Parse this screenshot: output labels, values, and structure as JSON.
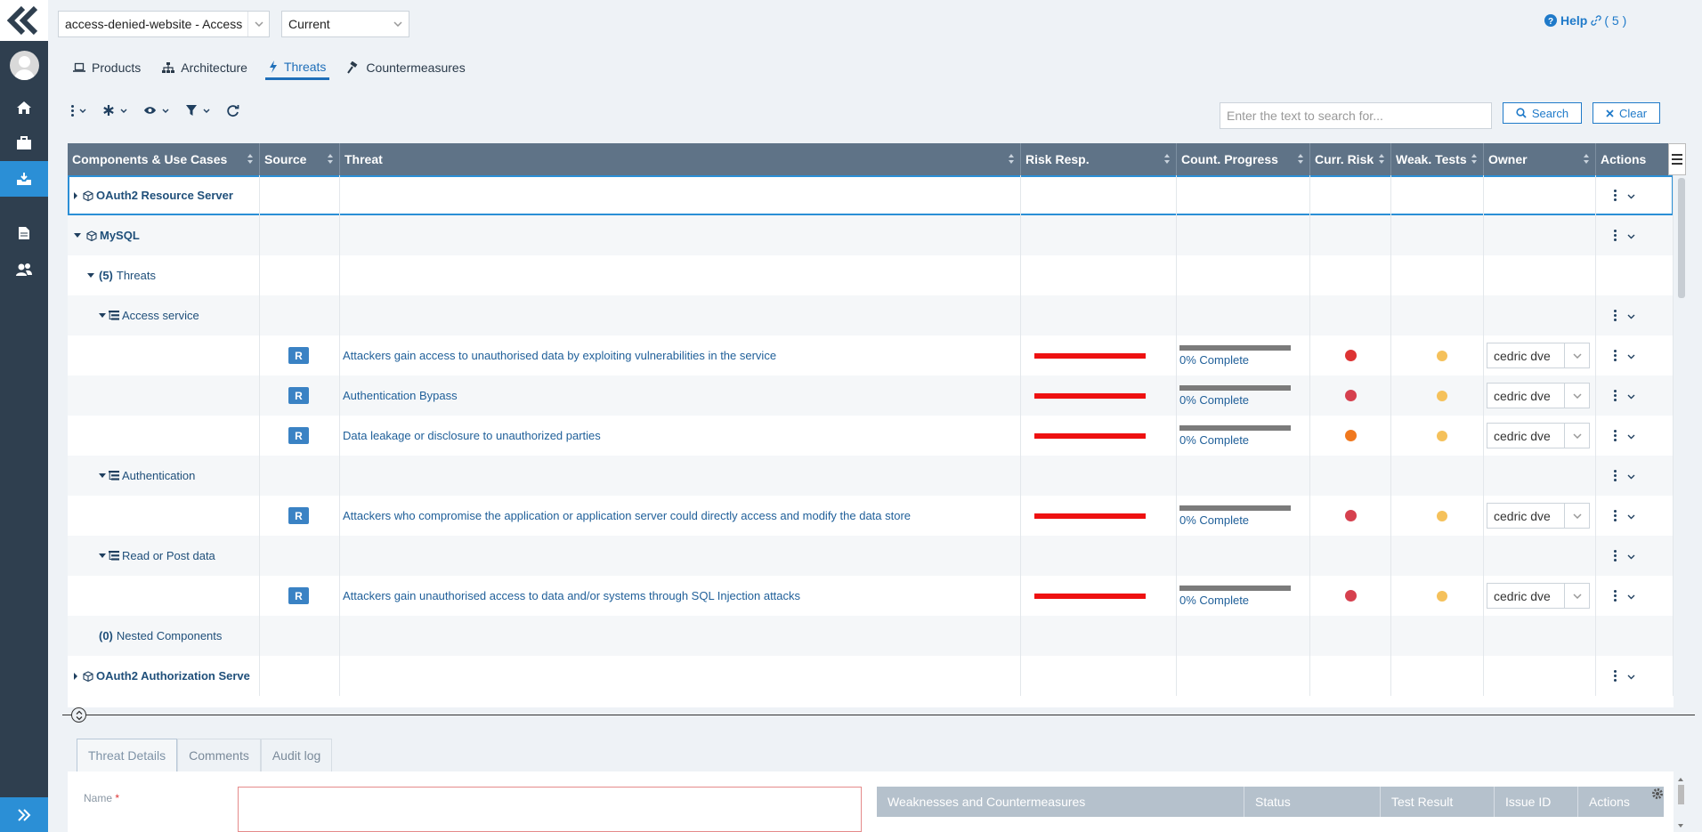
{
  "topbar": {
    "project": "access-denied-website - Access",
    "version": "Current",
    "help_label": "Help",
    "help_links": "( 5 )"
  },
  "tabs": [
    {
      "label": "Products",
      "icon": "laptop-icon"
    },
    {
      "label": "Architecture",
      "icon": "sitemap-icon"
    },
    {
      "label": "Threats",
      "icon": "bolt-icon",
      "active": true
    },
    {
      "label": "Countermeasures",
      "icon": "gavel-icon"
    }
  ],
  "search": {
    "placeholder": "Enter the text to search for...",
    "search_label": "Search",
    "clear_label": "Clear"
  },
  "grid": {
    "columns": [
      "Components & Use Cases",
      "Source",
      "Threat",
      "Risk Resp.",
      "Count. Progress",
      "Curr. Risk",
      "Weak. Tests",
      "Owner",
      "Actions"
    ],
    "rows": [
      {
        "type": "component",
        "label": "OAuth2 Resource Server",
        "expanded": false,
        "selected": true
      },
      {
        "type": "component",
        "label": "MySQL",
        "expanded": true
      },
      {
        "type": "threats-group",
        "count": "(5)",
        "label": "Threats"
      },
      {
        "type": "usecase",
        "label": "Access service"
      },
      {
        "type": "threat",
        "source": "R",
        "threat": "Attackers gain access to unauthorised data by exploiting vulnerabilities in the service",
        "progress": "0% Complete",
        "risk_color": "#dd3333",
        "weak_color": "#f5c15b",
        "owner": "cedric dve"
      },
      {
        "type": "threat",
        "source": "R",
        "threat": "Authentication Bypass",
        "progress": "0% Complete",
        "risk_color": "#d6404e",
        "weak_color": "#f5c15b",
        "owner": "cedric dve"
      },
      {
        "type": "threat",
        "source": "R",
        "threat": "Data leakage or disclosure to unauthorized parties",
        "progress": "0% Complete",
        "risk_color": "#f0781e",
        "weak_color": "#f5c15b",
        "owner": "cedric dve"
      },
      {
        "type": "usecase",
        "label": "Authentication"
      },
      {
        "type": "threat",
        "source": "R",
        "threat": "Attackers who compromise the application or application server could directly access and modify the data store",
        "progress": "0% Complete",
        "risk_color": "#d6404e",
        "weak_color": "#f5c15b",
        "owner": "cedric dve"
      },
      {
        "type": "usecase",
        "label": "Read or Post data"
      },
      {
        "type": "threat",
        "source": "R",
        "threat": "Attackers gain unauthorised access to data and/or systems through SQL Injection attacks",
        "progress": "0% Complete",
        "risk_color": "#d6404e",
        "weak_color": "#f5c15b",
        "owner": "cedric dve"
      },
      {
        "type": "nested",
        "count": "(0)",
        "label": "Nested Components"
      },
      {
        "type": "component",
        "label": "OAuth2 Authorization Serve",
        "expanded": false
      }
    ],
    "risk_bar_color": "#ee1111"
  },
  "bottom": {
    "tabs": [
      "Threat Details",
      "Comments",
      "Audit log"
    ],
    "name_label": "Name",
    "required_mark": "*",
    "wc_columns": [
      "Weaknesses and Countermeasures",
      "Status",
      "Test Result",
      "Issue ID",
      "Actions"
    ]
  },
  "colors": {
    "accent": "#2b8fd6",
    "nav_bg": "#2f3f4f",
    "grid_header": "#5f7387"
  }
}
